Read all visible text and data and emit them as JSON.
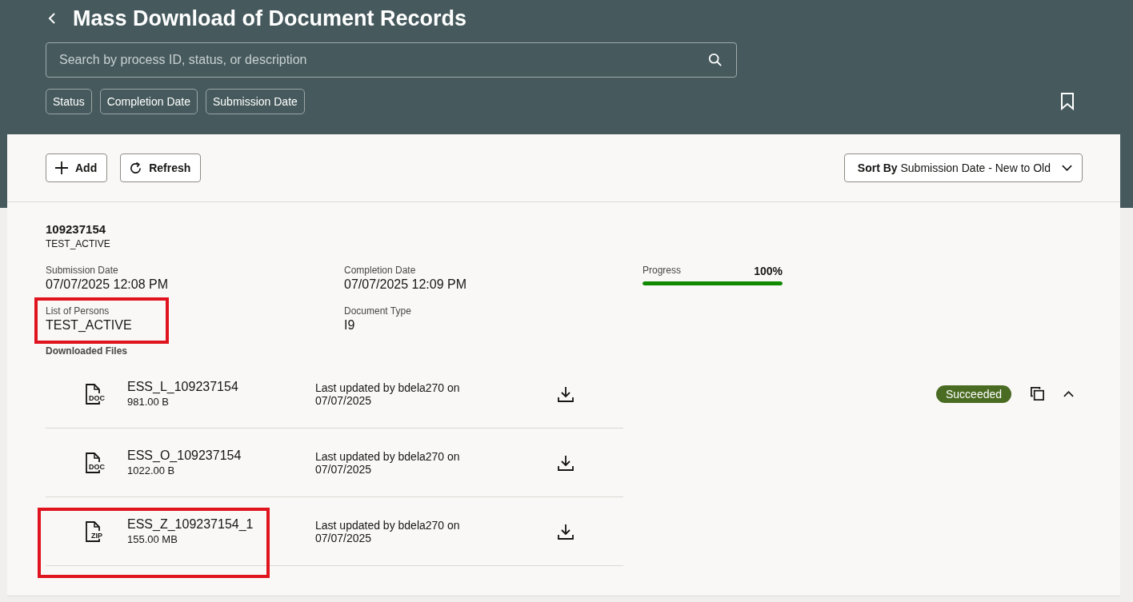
{
  "header": {
    "title": "Mass Download of Document Records",
    "search": {
      "placeholder": "Search by process ID, status, or description"
    },
    "filters": [
      "Status",
      "Completion Date",
      "Submission Date"
    ]
  },
  "toolbar": {
    "buttons": [
      {
        "kind": "add",
        "label": "Add"
      },
      {
        "kind": "refresh",
        "label": "Refresh"
      }
    ],
    "sort": {
      "label": "Sort By",
      "value": "Submission Date - New to Old"
    }
  },
  "record": {
    "id": "109237154",
    "subtitle": "TEST_ACTIVE",
    "fields": [
      {
        "kind": "text",
        "label": "Submission Date",
        "value": "07/07/2025 12:08 PM",
        "highlighted": false
      },
      {
        "kind": "text",
        "label": "Completion Date",
        "value": "07/07/2025 12:09 PM",
        "highlighted": false
      },
      {
        "kind": "progress",
        "label": "Progress",
        "reading": "100%",
        "level": 1
      },
      {
        "kind": "text",
        "label": "List of Persons",
        "value": "TEST_ACTIVE",
        "highlighted": true
      },
      {
        "kind": "text",
        "label": "Document Type",
        "value": "I9",
        "highlighted": false
      }
    ],
    "files_label": "Downloaded Files",
    "files": [
      {
        "type": "DOC",
        "name": "ESS_L_109237154",
        "size": "981.00 B",
        "updated": "Last updated by bdela270 on",
        "date": "07/07/2025",
        "highlighted": false
      },
      {
        "type": "DOC",
        "name": "ESS_O_109237154",
        "size": "1022.00 B",
        "updated": "Last updated by bdela270 on",
        "date": "07/07/2025",
        "highlighted": false
      },
      {
        "type": "ZIP",
        "name": "ESS_Z_109237154_1",
        "size": "155.00 MB",
        "updated": "Last updated by bdela270 on",
        "date": "07/07/2025",
        "highlighted": true
      }
    ],
    "status": {
      "label": "Succeeded",
      "color": "#4a6b22"
    },
    "expanded": true
  }
}
